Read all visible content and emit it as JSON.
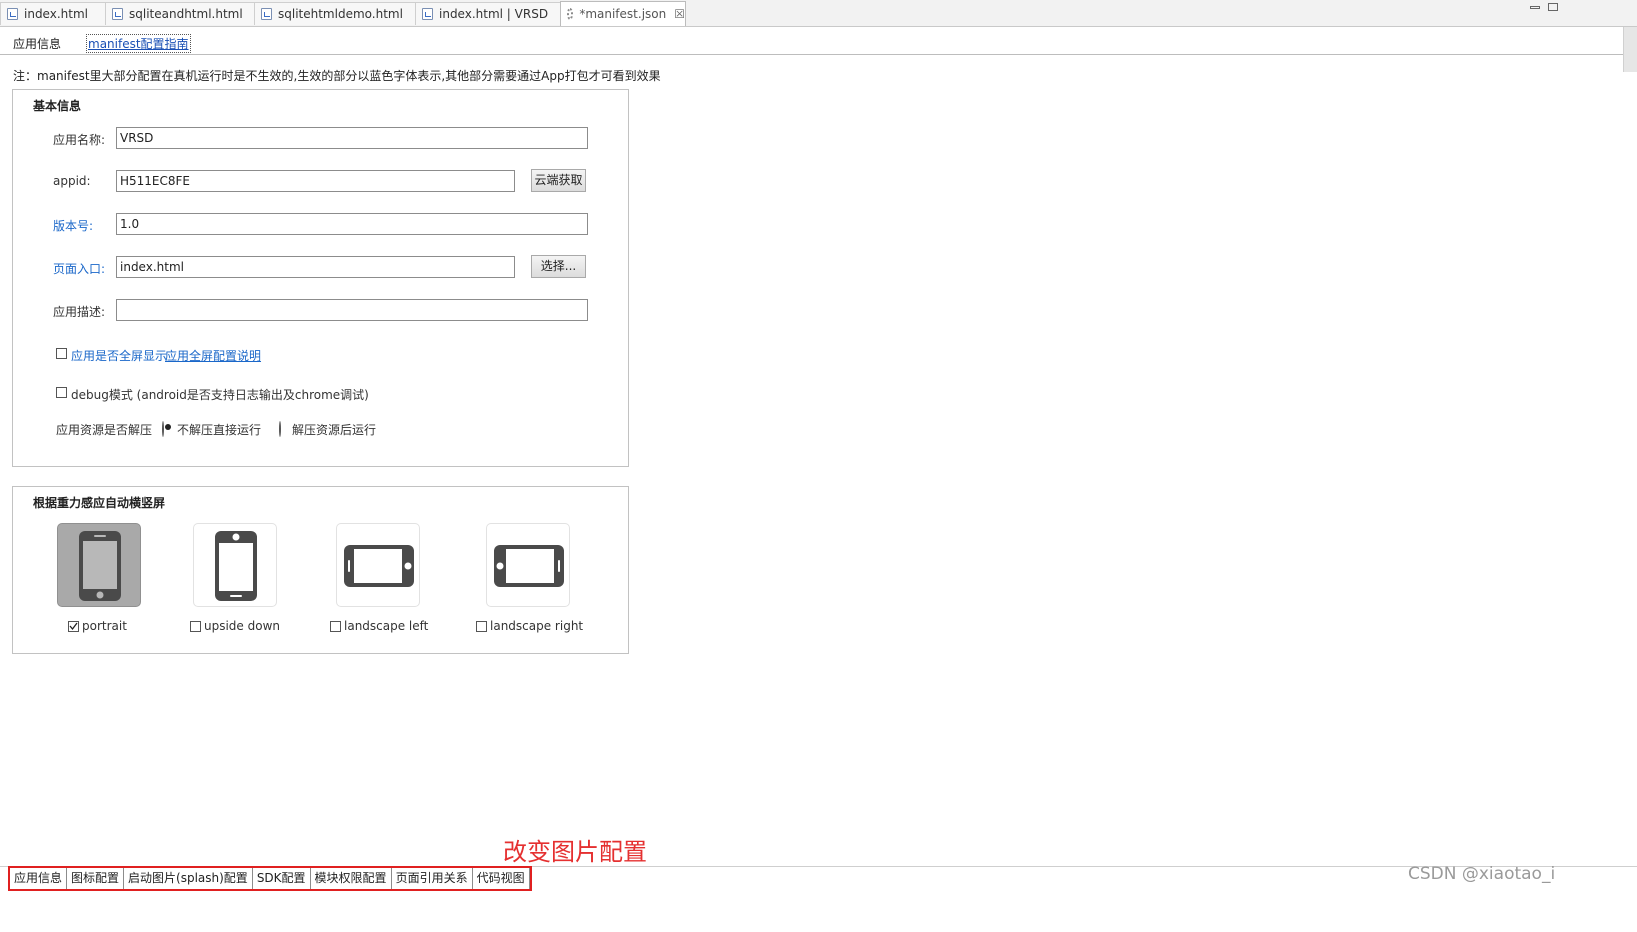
{
  "editor_tabs": [
    {
      "label": "index.html",
      "icon": "html-file-icon"
    },
    {
      "label": "sqliteandhtml.html",
      "icon": "html-file-icon"
    },
    {
      "label": "sqlitehtmldemo.html",
      "icon": "html-file-icon"
    },
    {
      "label": "index.html | VRSD",
      "icon": "html-file-icon"
    },
    {
      "label": "*manifest.json",
      "icon": "settings-file-icon",
      "active": true,
      "close": "☒"
    }
  ],
  "sub_tabs": {
    "app_info": "应用信息",
    "guide": "manifest配置指南"
  },
  "note": "注：manifest里大部分配置在真机运行时是不生效的,生效的部分以蓝色字体表示,其他部分需要通过App打包才可看到效果",
  "basic_info": {
    "title": "基本信息",
    "app_name": {
      "label": "应用名称:",
      "value": "VRSD"
    },
    "appid": {
      "label": "appid:",
      "value": "H511EC8FE",
      "button": "云端获取"
    },
    "version": {
      "label": "版本号:",
      "value": "1.0"
    },
    "entry": {
      "label": "页面入口:",
      "value": "index.html",
      "button": "选择..."
    },
    "description": {
      "label": "应用描述:",
      "value": ""
    },
    "fullscreen": {
      "label": "应用是否全屏显示",
      "link": "应用全屏配置说明",
      "checked": false
    },
    "debug": {
      "label": "debug模式 (android是否支持日志输出及chrome调试)",
      "checked": false
    },
    "unzip": {
      "label": "应用资源是否解压",
      "option1": "不解压直接运行",
      "option2": "解压资源后运行",
      "selected": "option1"
    }
  },
  "orientation": {
    "title": "根据重力感应自动横竖屏",
    "items": [
      {
        "label": "portrait",
        "checked": true,
        "icon": "portrait-phone-icon"
      },
      {
        "label": "upside down",
        "checked": false,
        "icon": "upside-down-phone-icon"
      },
      {
        "label": "landscape left",
        "checked": false,
        "icon": "landscape-left-phone-icon"
      },
      {
        "label": "landscape right",
        "checked": false,
        "icon": "landscape-right-phone-icon"
      }
    ]
  },
  "bottom_tabs": [
    "应用信息",
    "图标配置",
    "启动图片(splash)配置",
    "SDK配置",
    "模块权限配置",
    "页面引用关系",
    "代码视图"
  ],
  "annotation": "改变图片配置",
  "watermark": "CSDN @xiaotao_i",
  "colors": {
    "blue_label": "#1a67c9",
    "annotation_red": "#e53030",
    "selected_orientation_bg": "#a9a9a9"
  }
}
